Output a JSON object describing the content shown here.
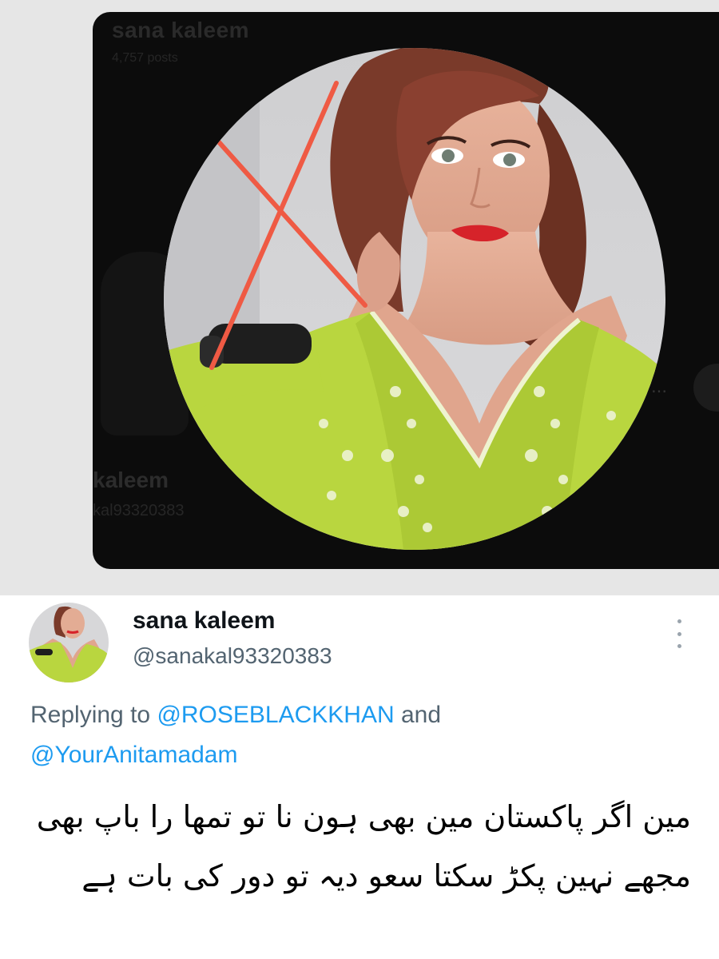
{
  "background_profile": {
    "name": "sana kaleem",
    "posts": "4,757 posts",
    "name_partial": "kaleem",
    "handle_partial": "kal93320383",
    "more_glyph": "..."
  },
  "tweet": {
    "display_name": "sana kaleem",
    "handle": "@sanakal93320383",
    "replying_to_prefix": "Replying to",
    "mention_1": "@ROSEBLACKKHAN",
    "and_text": "and",
    "mention_2": "@YourAnitamadam",
    "text": "مین اگر پاکستان مین بھی ہون نا تو تمھا را باپ بھی مجھے نہین پکڑ سکتا سعو دیہ تو دور کی بات ہے"
  },
  "colors": {
    "accent_link": "#1d9bf0",
    "secondary_text": "#536471",
    "primary_text": "#0f1419",
    "dark_card": "#0c0c0c",
    "outer_gray": "#e6e6e6",
    "dress_green": "#b9d63f",
    "cross_mark": "#ef5a44"
  },
  "icons": {
    "more_options": "more-vertical-icon",
    "cross_annotation": "red-x-mark"
  }
}
